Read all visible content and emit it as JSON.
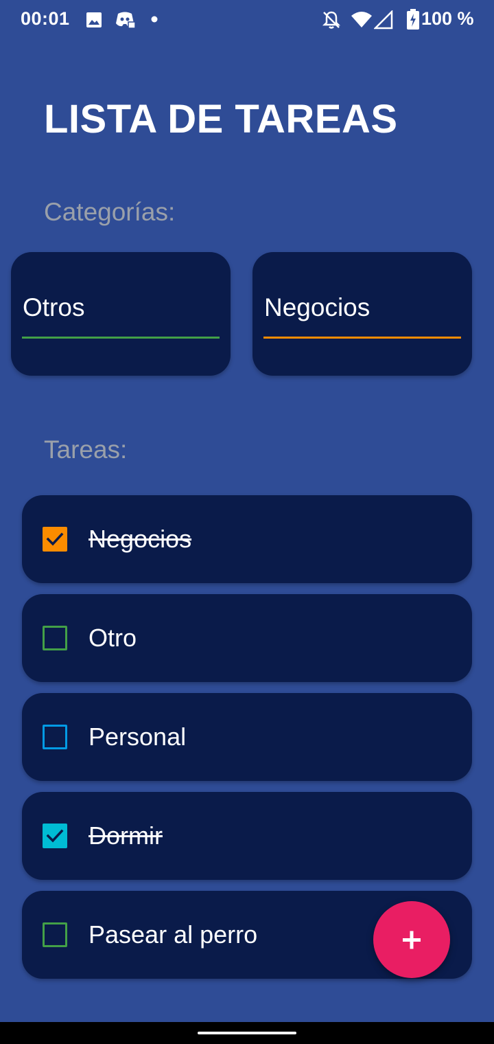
{
  "status_bar": {
    "time": "00:01",
    "battery_text": "100 %",
    "icons": [
      "image-icon",
      "discord-icon",
      "dot-icon",
      "bell-off-icon",
      "wifi-icon",
      "signal-icon",
      "battery-charging-icon"
    ]
  },
  "header": {
    "title": "LISTA DE TAREAS"
  },
  "categories": {
    "label": "Categorías:",
    "items": [
      {
        "name": "Otros",
        "color": "#43a047"
      },
      {
        "name": "Negocios",
        "color": "#fb8c00"
      }
    ]
  },
  "tasks": {
    "label": "Tareas:",
    "items": [
      {
        "text": "Negocios",
        "done": true,
        "color": "#fb8c00"
      },
      {
        "text": "Otro",
        "done": false,
        "color": "#43a047"
      },
      {
        "text": "Personal",
        "done": false,
        "color": "#039be5"
      },
      {
        "text": "Dormir",
        "done": true,
        "color": "#00bcd4"
      },
      {
        "text": "Pasear al perro",
        "done": false,
        "color": "#43a047"
      }
    ]
  },
  "fab": {
    "icon": "plus-icon",
    "color": "#e91e63"
  }
}
